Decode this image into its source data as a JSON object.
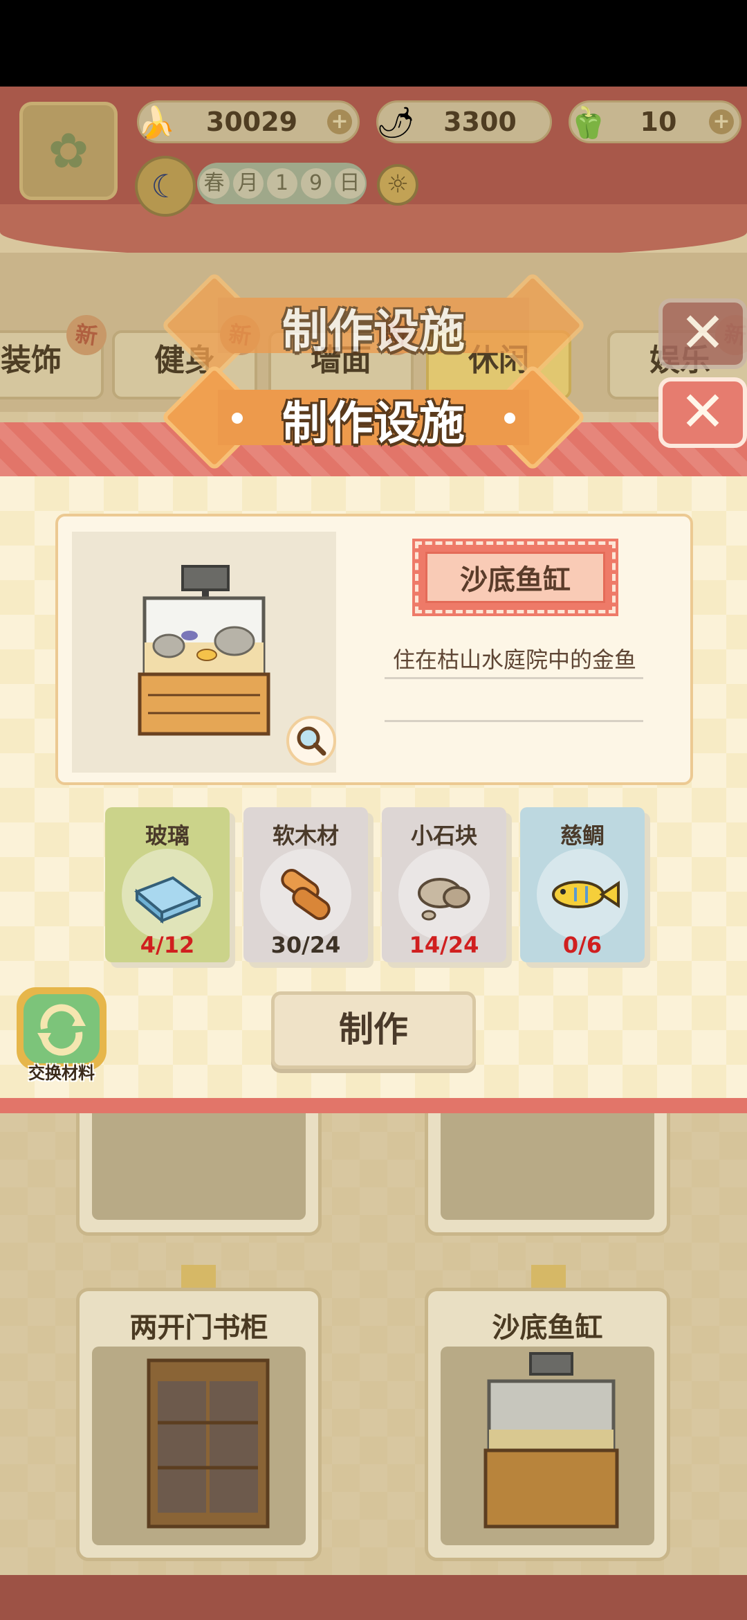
{
  "header": {
    "title": "制作设施",
    "resources": [
      {
        "icon": "banana-icon",
        "value": "30029"
      },
      {
        "icon": "flame-pepper-icon",
        "value": "3300"
      },
      {
        "icon": "blue-pepper-icon",
        "value": "10"
      }
    ],
    "date": [
      "春",
      "月",
      "1",
      "9",
      "日"
    ]
  },
  "tabs": [
    {
      "label": "装饰",
      "new": "新"
    },
    {
      "label": "健身",
      "new": "新"
    },
    {
      "label": "墙面",
      "new": "新"
    },
    {
      "label": "休闲",
      "new": ""
    },
    {
      "label": "娱乐",
      "new": "新"
    }
  ],
  "dialog": {
    "title": "制作设施",
    "item_name": "沙底鱼缸",
    "description": "住在枯山水庭院中的金鱼",
    "materials": [
      {
        "name": "玻璃",
        "count": "4/12",
        "color": "#cbd38a",
        "sufficient": false
      },
      {
        "name": "软木材",
        "count": "30/24",
        "color": "#ddd6d4",
        "sufficient": true
      },
      {
        "name": "小石块",
        "count": "14/24",
        "color": "#ddd6d4",
        "sufficient": false
      },
      {
        "name": "慈鲷",
        "count": "0/6",
        "color": "#bdd8e0",
        "sufficient": false
      }
    ],
    "craft_label": "制作",
    "exchange_label": "交换材料"
  },
  "cards": [
    {
      "name": "两开门书柜"
    },
    {
      "name": "沙底鱼缸"
    }
  ],
  "colors": {
    "accent_orange": "#ed9a4c",
    "stripe_red": "#e27569",
    "insufficient_red": "#d01f1f"
  }
}
